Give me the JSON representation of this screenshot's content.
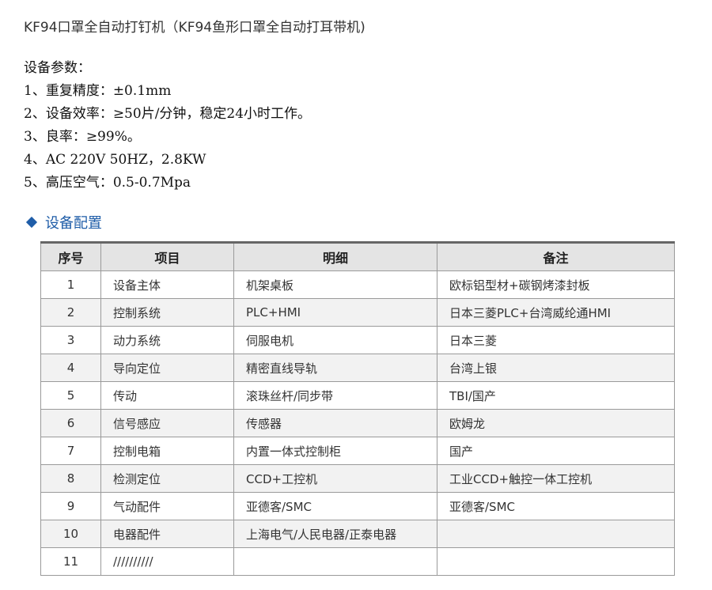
{
  "title": "KF94口罩全自动打钉机（KF94鱼形口罩全自动打耳带机)",
  "params": {
    "heading": "设备参数：",
    "lines": [
      "1、重复精度：±0.1mm",
      "2、设备效率：≥50片/分钟，稳定24小时工作。",
      "3、良率：≥99%。",
      "4、AC 220V 50HZ，2.8KW",
      "5、高压空气：0.5-0.7Mpa"
    ]
  },
  "config": {
    "heading": "设备配置",
    "headers": [
      "序号",
      "项目",
      "明细",
      "备注"
    ],
    "rows": [
      [
        "1",
        "设备主体",
        "机架桌板",
        "欧标铝型材+碳钢烤漆封板"
      ],
      [
        "2",
        "控制系统",
        "PLC+HMI",
        "日本三菱PLC+台湾威纶通HMI"
      ],
      [
        "3",
        "动力系统",
        "伺服电机",
        "日本三菱"
      ],
      [
        "4",
        "导向定位",
        "精密直线导轨",
        "台湾上银"
      ],
      [
        "5",
        "传动",
        "滚珠丝杆/同步带",
        "TBI/国产"
      ],
      [
        "6",
        "信号感应",
        "传感器",
        "欧姆龙"
      ],
      [
        "7",
        "控制电箱",
        "内置一体式控制柜",
        "国产"
      ],
      [
        "8",
        "检测定位",
        "CCD+工控机",
        "工业CCD+触控一体工控机"
      ],
      [
        "9",
        "气动配件",
        "亚德客/SMC",
        "亚德客/SMC"
      ],
      [
        "10",
        "电器配件",
        "上海电气/人民电器/正泰电器",
        ""
      ],
      [
        "11",
        "//////////",
        "",
        ""
      ]
    ]
  }
}
